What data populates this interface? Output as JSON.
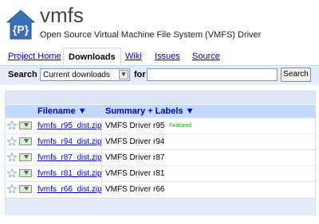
{
  "header": {
    "title": "vmfs",
    "subtitle": "Open Source Virtual Machine File System (VMFS) Driver",
    "logo_letter": "{P}"
  },
  "tabs": [
    {
      "label": "Project Home",
      "active": false
    },
    {
      "label": "Downloads",
      "active": true
    },
    {
      "label": "Wiki",
      "active": false
    },
    {
      "label": "Issues",
      "active": false
    },
    {
      "label": "Source",
      "active": false
    }
  ],
  "search": {
    "label": "Search",
    "selected": "Current downloads",
    "for_label": "for",
    "query": "",
    "button": "Search"
  },
  "table": {
    "headers": {
      "filename": "Filename ▼",
      "summary": "Summary + Labels ▼"
    },
    "rows": [
      {
        "filename": "fvmfs_r95_dist.zip",
        "summary": "VMFS Driver r95",
        "label": "Featured"
      },
      {
        "filename": "fvmfs_r94_dist.zip",
        "summary": "VMFS Driver r94",
        "label": ""
      },
      {
        "filename": "fvmfs_r87_dist.zip",
        "summary": "VMFS Driver r87",
        "label": ""
      },
      {
        "filename": "fvmfs_r81_dist.zip",
        "summary": "VMFS Driver r81",
        "label": ""
      },
      {
        "filename": "fvmfs_r66_dist.zip",
        "summary": "VMFS Driver r66",
        "label": ""
      }
    ]
  },
  "colors": {
    "link": "#0000cc",
    "tab_border": "#c3d9ff",
    "header_bg": "#c3d9ff",
    "searchbar_bg": "#e5ecf9",
    "featured": "#00aa00",
    "logo": "#3b6fb6"
  }
}
